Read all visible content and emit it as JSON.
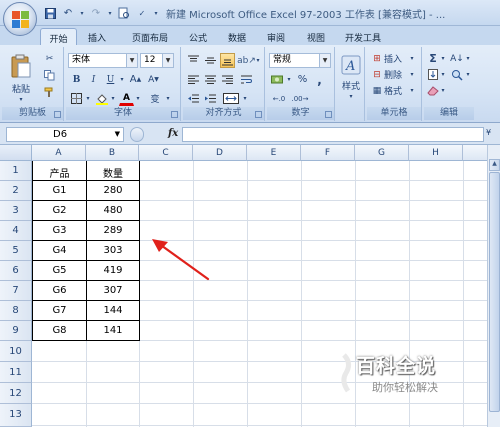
{
  "window": {
    "title": "新建 Microsoft Office Excel 97-2003 工作表 [兼容模式] - ..."
  },
  "tabs": [
    "开始",
    "插入",
    "页面布局",
    "公式",
    "数据",
    "审阅",
    "视图",
    "开发工具"
  ],
  "ribbon": {
    "clipboard": {
      "paste_label": "粘贴",
      "group_label": "剪贴板"
    },
    "font": {
      "font_name": "宋体",
      "font_size": "12",
      "group_label": "字体",
      "bold": "B",
      "italic": "I",
      "underline": "U",
      "phonetic": "变"
    },
    "alignment": {
      "group_label": "对齐方式"
    },
    "number": {
      "format": "常规",
      "percent": "%",
      "comma": ",",
      "group_label": "数字"
    },
    "styles": {
      "label": "样式"
    },
    "cells": {
      "insert": "插入",
      "delete": "删除",
      "format": "格式",
      "group_label": "单元格"
    },
    "editing": {
      "sigma": "Σ",
      "group_label": "编辑"
    }
  },
  "formula_bar": {
    "name_box": "D6",
    "fx": "fx",
    "formula": ""
  },
  "sheet": {
    "columns": [
      "A",
      "B",
      "C",
      "D",
      "E",
      "F",
      "G",
      "H"
    ],
    "rows": [
      "1",
      "2",
      "3",
      "4",
      "5",
      "6",
      "7",
      "8",
      "9",
      "10",
      "11",
      "12",
      "13"
    ],
    "cells": [
      [
        "产品",
        "数量"
      ],
      [
        "G1",
        "280"
      ],
      [
        "G2",
        "480"
      ],
      [
        "G3",
        "289"
      ],
      [
        "G4",
        "303"
      ],
      [
        "G5",
        "419"
      ],
      [
        "G6",
        "307"
      ],
      [
        "G7",
        "144"
      ],
      [
        "G8",
        "141"
      ]
    ]
  },
  "watermark": {
    "title": "百科全说",
    "subtitle": "助你轻松解决"
  },
  "colors": {
    "accent": "#2b5797",
    "annotation_arrow": "#e0211b"
  }
}
